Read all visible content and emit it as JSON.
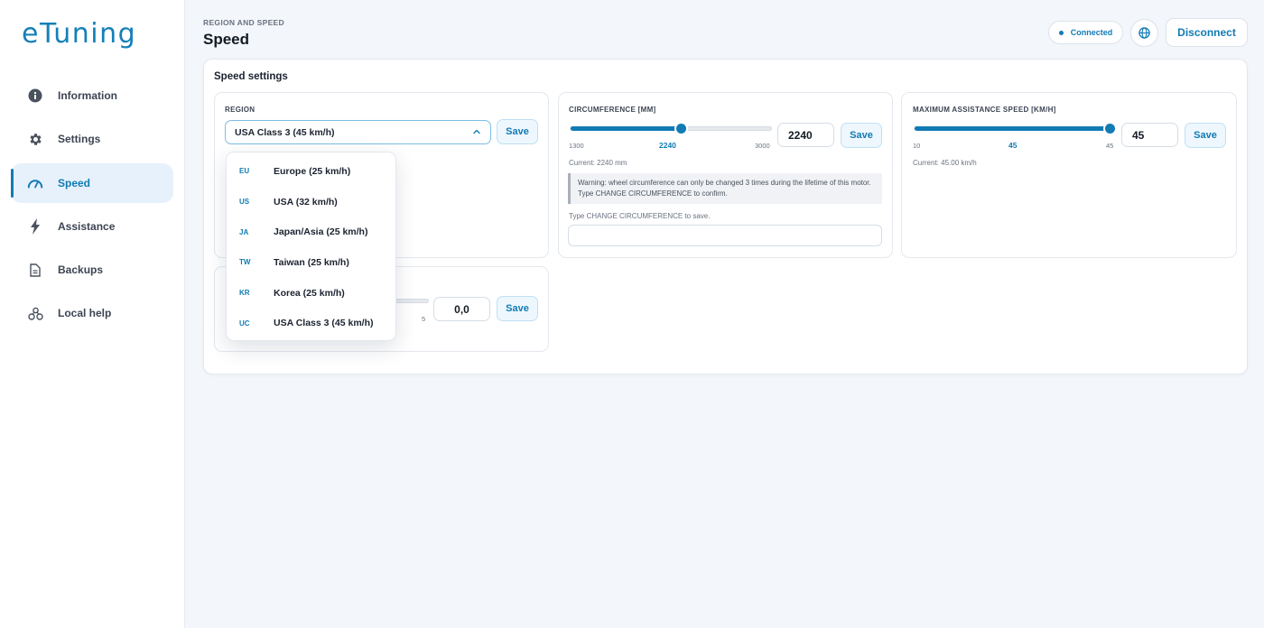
{
  "app": {
    "logo": "eTuning"
  },
  "sidebar": {
    "items": [
      {
        "label": "Information",
        "icon": "info-icon",
        "active": false
      },
      {
        "label": "Settings",
        "icon": "gear-icon",
        "active": false
      },
      {
        "label": "Speed",
        "icon": "speedometer-icon",
        "active": true
      },
      {
        "label": "Assistance",
        "icon": "lightning-icon",
        "active": false
      },
      {
        "label": "Backups",
        "icon": "document-icon",
        "active": false
      },
      {
        "label": "Local help",
        "icon": "route-icon",
        "active": false
      }
    ]
  },
  "header": {
    "eyebrow": "REGION AND SPEED",
    "title": "Speed",
    "status": "Connected",
    "disconnect_label": "Disconnect"
  },
  "card": {
    "title": "Speed settings"
  },
  "region": {
    "label": "REGION",
    "selected": "USA Class 3 (45 km/h)",
    "save_label": "Save",
    "options": [
      {
        "code": "EU",
        "name": "Europe (25 km/h)"
      },
      {
        "code": "US",
        "name": "USA (32 km/h)"
      },
      {
        "code": "JA",
        "name": "Japan/Asia (25 km/h)"
      },
      {
        "code": "TW",
        "name": "Taiwan (25 km/h)"
      },
      {
        "code": "KR",
        "name": "Korea (25 km/h)"
      },
      {
        "code": "UC",
        "name": "USA Class 3 (45 km/h)"
      }
    ]
  },
  "circumference": {
    "label": "CIRCUMFERENCE [MM]",
    "min": "1300",
    "max": "3000",
    "current_tick": "2240",
    "value": "2240",
    "value_fraction": 0.5529,
    "save_label": "Save",
    "current_text": "Current: 2240 mm",
    "warning": "Warning: wheel circumference can only be changed 3 times during the lifetime of this motor. Type CHANGE CIRCUMFERENCE to confirm.",
    "type_note": "Type CHANGE CIRCUMFERENCE to save.",
    "confirm_value": ""
  },
  "max_speed": {
    "label": "MAXIMUM ASSISTANCE SPEED [KM/H]",
    "min": "10",
    "max": "45",
    "current_tick": "45",
    "value": "45",
    "value_fraction": 1.0,
    "save_label": "Save",
    "current_text": "Current: 45.00 km/h"
  },
  "fourth_setting": {
    "max": "5",
    "value": "0,0",
    "save_label": "Save"
  }
}
